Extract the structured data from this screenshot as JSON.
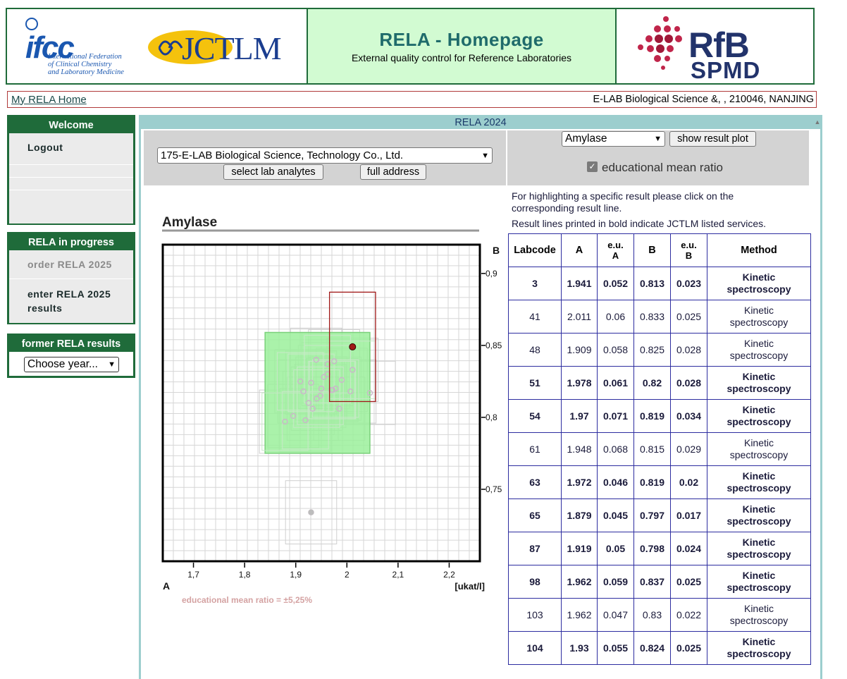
{
  "header": {
    "title": "RELA - Homepage",
    "subtitle": "External quality control for Reference Laboratories",
    "ifcc_word": "ifcc",
    "ifcc_lines": [
      "International Federation",
      "of Clinical Chemistry",
      "and Laboratory Medicine"
    ],
    "jctlm_word": "JCTLM",
    "rfb_word": "RfB",
    "spmd_word": "SPMD"
  },
  "topbar": {
    "home_link": "My RELA Home",
    "lab_info": "E-LAB Biological Science &, , 210046, NANJING"
  },
  "sidebar": {
    "welcome": {
      "heading": "Welcome",
      "items": [
        "Logout"
      ]
    },
    "progress": {
      "heading": "RELA in progress",
      "items": [
        "order RELA 2025",
        "enter RELA 2025 results"
      ]
    },
    "former": {
      "heading": "former RELA results",
      "select_value": "Choose year..."
    }
  },
  "main": {
    "bar_title": "RELA 2024",
    "lab_select": "175-E-LAB Biological Science, Technology Co., Ltd.",
    "select_analytes_btn": "select lab analytes",
    "full_address_btn": "full address",
    "analyte_select": "Amylase",
    "show_plot_btn": "show result plot",
    "checkbox_label": "educational mean ratio",
    "checkbox_checked": true,
    "note1": "For highlighting a specific result please click on the corresponding result line.",
    "note2": "Result lines printed in bold indicate JCTLM listed services."
  },
  "table": {
    "headers": [
      "Labcode",
      "A",
      "e.u. A",
      "B",
      "e.u. B",
      "Method"
    ],
    "rows": [
      {
        "labcode": "3",
        "a": "1.941",
        "eua": "0.052",
        "b": "0.813",
        "eub": "0.023",
        "method": "Kinetic spectroscopy",
        "bold": true
      },
      {
        "labcode": "41",
        "a": "2.011",
        "eua": "0.06",
        "b": "0.833",
        "eub": "0.025",
        "method": "Kinetic spectroscopy",
        "bold": false
      },
      {
        "labcode": "48",
        "a": "1.909",
        "eua": "0.058",
        "b": "0.825",
        "eub": "0.028",
        "method": "Kinetic spectroscopy",
        "bold": false
      },
      {
        "labcode": "51",
        "a": "1.978",
        "eua": "0.061",
        "b": "0.82",
        "eub": "0.028",
        "method": "Kinetic spectroscopy",
        "bold": true
      },
      {
        "labcode": "54",
        "a": "1.97",
        "eua": "0.071",
        "b": "0.819",
        "eub": "0.034",
        "method": "Kinetic spectroscopy",
        "bold": true
      },
      {
        "labcode": "61",
        "a": "1.948",
        "eua": "0.068",
        "b": "0.815",
        "eub": "0.029",
        "method": "Kinetic spectroscopy",
        "bold": false
      },
      {
        "labcode": "63",
        "a": "1.972",
        "eua": "0.046",
        "b": "0.819",
        "eub": "0.02",
        "method": "Kinetic spectroscopy",
        "bold": true
      },
      {
        "labcode": "65",
        "a": "1.879",
        "eua": "0.045",
        "b": "0.797",
        "eub": "0.017",
        "method": "Kinetic spectroscopy",
        "bold": true
      },
      {
        "labcode": "87",
        "a": "1.919",
        "eua": "0.05",
        "b": "0.798",
        "eub": "0.024",
        "method": "Kinetic spectroscopy",
        "bold": true
      },
      {
        "labcode": "98",
        "a": "1.962",
        "eua": "0.059",
        "b": "0.837",
        "eub": "0.025",
        "method": "Kinetic spectroscopy",
        "bold": true
      },
      {
        "labcode": "103",
        "a": "1.962",
        "eua": "0.047",
        "b": "0.83",
        "eub": "0.022",
        "method": "Kinetic spectroscopy",
        "bold": false
      },
      {
        "labcode": "104",
        "a": "1.93",
        "eua": "0.055",
        "b": "0.824",
        "eub": "0.025",
        "method": "Kinetic spectroscopy",
        "bold": true
      }
    ]
  },
  "chart_data": {
    "type": "scatter",
    "title": "Amylase",
    "x_axis_name": "A",
    "y_axis_name": "B",
    "x_unit": "[ukat/l]",
    "xlim": [
      1.64,
      2.26
    ],
    "ylim": [
      0.7,
      0.92
    ],
    "x_ticks": [
      "1,7",
      "1,8",
      "1,9",
      "2",
      "2,1",
      "2,2"
    ],
    "y_ticks": [
      "0,9",
      "0,85",
      "0,8",
      "0,75"
    ],
    "footnote": "educational mean ratio = ±5,25%",
    "target_box": {
      "x": [
        1.84,
        2.045
      ],
      "y": [
        0.775,
        0.859
      ]
    },
    "highlight": {
      "x": 2.011,
      "y": 0.849,
      "dx": 0.045,
      "dy": 0.038
    },
    "points": [
      {
        "x": 1.941,
        "y": 0.813
      },
      {
        "x": 2.011,
        "y": 0.833
      },
      {
        "x": 1.909,
        "y": 0.825
      },
      {
        "x": 1.978,
        "y": 0.82
      },
      {
        "x": 1.97,
        "y": 0.819
      },
      {
        "x": 1.948,
        "y": 0.815
      },
      {
        "x": 1.972,
        "y": 0.819
      },
      {
        "x": 1.879,
        "y": 0.797
      },
      {
        "x": 1.919,
        "y": 0.798
      },
      {
        "x": 1.962,
        "y": 0.837
      },
      {
        "x": 1.962,
        "y": 0.83
      },
      {
        "x": 1.93,
        "y": 0.824
      },
      {
        "x": 1.94,
        "y": 0.84
      },
      {
        "x": 1.955,
        "y": 0.828
      },
      {
        "x": 1.925,
        "y": 0.81
      },
      {
        "x": 1.933,
        "y": 0.806
      },
      {
        "x": 1.895,
        "y": 0.801
      },
      {
        "x": 1.915,
        "y": 0.818
      },
      {
        "x": 1.985,
        "y": 0.806
      },
      {
        "x": 2.007,
        "y": 0.818
      },
      {
        "x": 1.99,
        "y": 0.826
      },
      {
        "x": 2.045,
        "y": 0.817
      },
      {
        "x": 1.95,
        "y": 0.82
      },
      {
        "x": 1.975,
        "y": 0.839
      },
      {
        "x": 1.93,
        "y": 0.734
      }
    ],
    "colors": {
      "target_fill": "#9bf09b",
      "target_stroke": "#7ad07a",
      "highlight": "#a01818",
      "box": "#cfcfcf",
      "point": "#cfcfcf"
    }
  }
}
